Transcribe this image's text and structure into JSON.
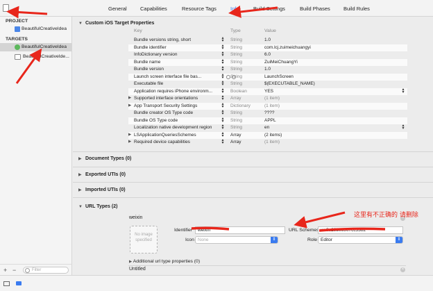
{
  "tabs": [
    "General",
    "Capabilities",
    "Resource Tags",
    "Info",
    "Build Settings",
    "Build Phases",
    "Build Rules"
  ],
  "active_tab": "Info",
  "sidebar": {
    "project_header": "PROJECT",
    "project_item": "BeautifulCreativeIdea",
    "targets_header": "TARGETS",
    "target_items": [
      "BeautifulCreativeIdea",
      "BeautifulCreativeIde..."
    ],
    "add_label": "+",
    "remove_label": "−",
    "filter_placeholder": "Filter"
  },
  "custom_props": {
    "title": "Custom iOS Target Properties",
    "headers": {
      "key": "Key",
      "type": "Type",
      "value": "Value"
    },
    "rows": [
      {
        "key": "Bundle versions string, short",
        "type": "String",
        "value": "1.0"
      },
      {
        "key": "Bundle identifier",
        "type": "String",
        "value": "com.lcj.zuimeichuangyi"
      },
      {
        "key": "InfoDictionary version",
        "type": "String",
        "value": "6.0"
      },
      {
        "key": "Bundle name",
        "type": "String",
        "value": "ZuiMeiChuangYi"
      },
      {
        "key": "Bundle version",
        "type": "String",
        "value": "1.0"
      },
      {
        "key": "Launch screen interface file bas...",
        "type": "String",
        "value": "LaunchScreen"
      },
      {
        "key": "Executable file",
        "type": "String",
        "value": "$(EXECUTABLE_NAME)"
      },
      {
        "key": "Application requires iPhone environm...",
        "type": "Boolean",
        "value": "YES"
      },
      {
        "key": "Supported interface orientations",
        "type": "Array",
        "value": "(1 item)"
      },
      {
        "key": "App Transport Security Settings",
        "type": "Dictionary",
        "value": "(1 item)"
      },
      {
        "key": "Bundle creator OS Type code",
        "type": "String",
        "value": "????"
      },
      {
        "key": "Bundle OS Type code",
        "type": "String",
        "value": "APPL"
      },
      {
        "key": "Localization native development region",
        "type": "String",
        "value": "en"
      },
      {
        "key": "LSApplicationQueriesSchemes",
        "type": "Array",
        "value": "(2 items)"
      },
      {
        "key": "Required device capabilities",
        "type": "Array",
        "value": "(1 item)"
      }
    ]
  },
  "sections": {
    "document_types": "Document Types (0)",
    "exported_utis": "Exported UTIs (0)",
    "imported_utis": "Imported UTIs (0)",
    "url_types": "URL Types (2)"
  },
  "url_type": {
    "name": "weixin",
    "image_placeholder": "No image specified",
    "identifier_label": "Identifier",
    "identifier_value": "weixin",
    "icon_label": "Icon",
    "icon_value": "None",
    "url_schemes_label": "URL Schemes",
    "url_schemes_value": "wx8e29306907cc5382",
    "role_label": "Role",
    "role_value": "Editor",
    "additional_label": "Additional url type properties (0)",
    "untitled_label": "Untitled"
  },
  "annotation": "这里有不正确的 请删除",
  "colors": {
    "accent": "#3a7bf0",
    "annotation": "#e8261b"
  }
}
